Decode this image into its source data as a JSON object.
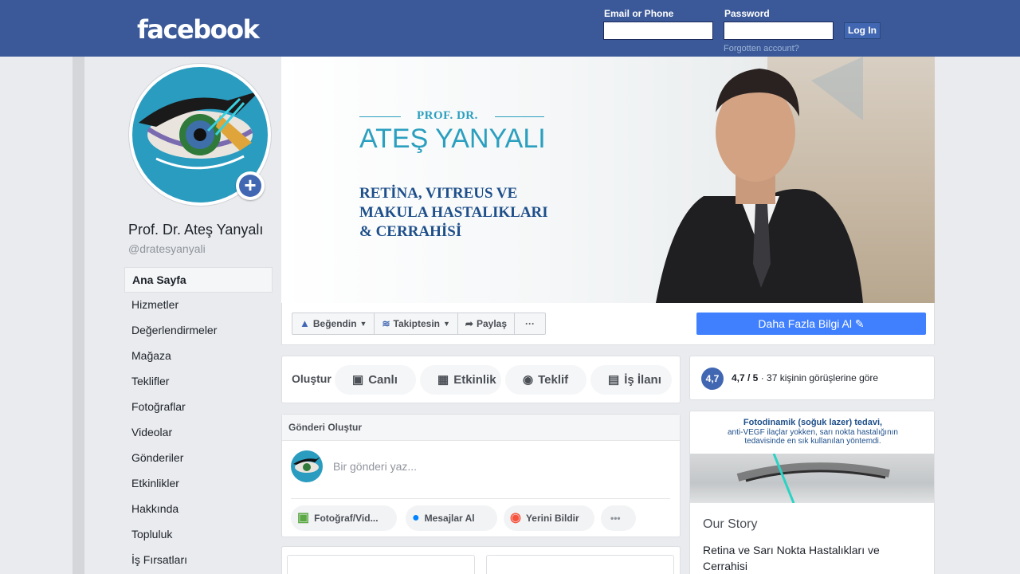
{
  "header": {
    "logo": "facebook",
    "email_label": "Email or Phone",
    "password_label": "Password",
    "login_button": "Log In",
    "forgot_link": "Forgotten account?",
    "bar_color": "#3b5998"
  },
  "profile": {
    "name": "Prof. Dr. Ateş Yanyalı",
    "handle": "@dratesyanyali"
  },
  "nav": {
    "items": [
      {
        "label": "Ana Sayfa",
        "active": true
      },
      {
        "label": "Hizmetler"
      },
      {
        "label": "Değerlendirmeler"
      },
      {
        "label": "Mağaza"
      },
      {
        "label": "Teklifler"
      },
      {
        "label": "Fotoğraflar"
      },
      {
        "label": "Videolar"
      },
      {
        "label": "Gönderiler"
      },
      {
        "label": "Etkinlikler"
      },
      {
        "label": "Hakkında"
      },
      {
        "label": "Topluluk"
      },
      {
        "label": "İş Fırsatları"
      }
    ]
  },
  "cover": {
    "prof": "PROF. DR.",
    "name": "ATEŞ YANYALI",
    "sub1": "RETİNA, VITREUS VE",
    "sub2": "MAKULA HASTALIKLARI",
    "sub3": "& CERRAHİSİ"
  },
  "actions": {
    "like": "Beğendin",
    "follow": "Takiptesin",
    "share": "Paylaş",
    "more": "···",
    "cta": "Daha Fazla Bilgi Al",
    "cta_color": "#4080ff"
  },
  "create": {
    "label": "Oluştur",
    "live": "Canlı",
    "event": "Etkinlik",
    "offer": "Teklif",
    "job": "İş İlanı"
  },
  "composer": {
    "header": "Gönderi Oluştur",
    "placeholder": "Bir gönderi yaz...",
    "photo": "Fotoğraf/Vid...",
    "message": "Mesajlar Al",
    "checkin": "Yerini Bildir",
    "more": "•••"
  },
  "rating": {
    "badge": "4,7",
    "score": "4,7 / 5",
    "text": " · 37 kişinin görüşlerine göre"
  },
  "story": {
    "img_title": "Fotodinamik (soğuk lazer) tedavi,",
    "img_line1": "anti-VEGF ilaçlar yokken, sarı nokta hastalığının",
    "img_line2": "tedavisinde en sık kullanılan yöntemdi.",
    "title": "Our Story",
    "text": "Retina ve Sarı Nokta Hastalıkları ve Cerrahisi"
  }
}
